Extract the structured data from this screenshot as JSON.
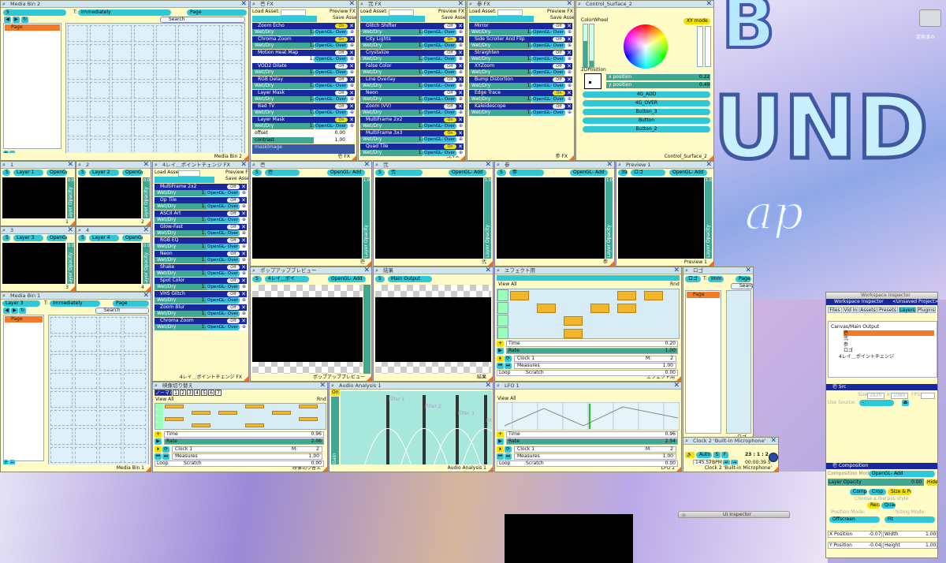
{
  "colors": {
    "panel": "#fffcc8",
    "accent": "#2ec8d8",
    "navy": "#1a28a0",
    "orange": "#f27b2a",
    "yellow": "#f3e000",
    "teal": "#3fa895"
  },
  "media_bin_2": {
    "title": "Media Bin 2",
    "trigger_label": "T:",
    "trigger_value": "Immediately",
    "page_label": "Page",
    "search": "Search",
    "list_item": "Page",
    "footer": "Media Bin 2"
  },
  "fx1": {
    "title": "壱 FX",
    "load_asset": "Load Asset:",
    "preview": "Preview FX",
    "save": "Save Asset",
    "footer": "壱 FX",
    "rows": [
      {
        "name": "Zoom Echo",
        "state": "On"
      },
      {
        "name": "Chroma Zoom",
        "state": "On"
      },
      {
        "name": "Motion Heat Map",
        "state": "Off"
      },
      {
        "name": "VOD2 Dilate",
        "state": "Off"
      },
      {
        "name": "RGB Delay",
        "state": "Off"
      },
      {
        "name": "Layer Mask",
        "state": "Off"
      },
      {
        "name": "Bad TV",
        "state": "Off"
      },
      {
        "name": "Layer Mask",
        "state": "On"
      }
    ],
    "wet": "Wet/Dry",
    "wet_val": "1.00",
    "wet_val0": "0.00",
    "blend": "OpenGL- Over",
    "offset_label": "offset",
    "offset_val": "0.00",
    "contrast_label": "contrast",
    "contrast_val": "1.00",
    "maskimage": "maskImage"
  },
  "fx2": {
    "title": "弐 FX",
    "load_asset": "Load Asset:",
    "preview": "Preview FX",
    "save": "Save Asset",
    "footer": "弐 FX",
    "rows": [
      {
        "name": "Glitch Shifter",
        "state": "Off"
      },
      {
        "name": "City Lights",
        "state": "On"
      },
      {
        "name": "Crystalize",
        "state": "Off"
      },
      {
        "name": "False Color",
        "state": "Off"
      },
      {
        "name": "Line Overlay",
        "state": "Off"
      },
      {
        "name": "Neon",
        "state": "Off"
      },
      {
        "name": "Zoom (VV)",
        "state": "Off"
      },
      {
        "name": "MultiFrame 2x2",
        "state": "On"
      },
      {
        "name": "MultiFrame 3x3",
        "state": "On"
      },
      {
        "name": "Quad Tile",
        "state": "On"
      }
    ],
    "wet": "Wet/Dry",
    "wet_val": "1.00",
    "blend": "OpenGL- Over"
  },
  "fx3": {
    "title": "参 FX",
    "load_asset": "Load Asset:",
    "preview": "Preview FX",
    "save": "Save Asset",
    "footer": "参 FX",
    "rows": [
      {
        "name": "Mirror",
        "state": "Off"
      },
      {
        "name": "Side Scroller And Flip",
        "state": "Off"
      },
      {
        "name": "Straighten",
        "state": "Off"
      },
      {
        "name": "XYZoom",
        "state": "Off"
      },
      {
        "name": "Bump Distortion",
        "state": "Off"
      },
      {
        "name": "Edge Trace",
        "state": "On"
      },
      {
        "name": "Kaleidescope",
        "state": "Off"
      }
    ],
    "wet": "Wet/Dry",
    "wet_val": "1.00",
    "blend": "OpenGL- Over"
  },
  "control_surface": {
    "title": "Control_Surface_2",
    "colorwheel": "ColorWheel",
    "xymode": "XY mode",
    "pos2d": "2DPosition",
    "xpos": "x position",
    "xval": "0.22",
    "ypos": "y position",
    "yval": "0.49",
    "buttons": [
      "4G_ADD",
      "4G_OVER",
      "Button_3",
      "Button",
      "Button_2"
    ],
    "sat": "Saturation",
    "val": "Value",
    "footer": "Control_Surface_2",
    "sliders": [
      "0.38",
      "0.14"
    ]
  },
  "layers": [
    {
      "num": "1",
      "title": "1",
      "layer": "Layer 1",
      "blend": "OpenGL-",
      "opacity": "Layer Opacity",
      "op_val": "0.00",
      "idx": "5",
      "badge": "1"
    },
    {
      "num": "2",
      "title": "2",
      "layer": "Layer 2",
      "blend": "OpenGL-",
      "opacity": "Layer Opacity",
      "op_val": "0.00",
      "idx": "5",
      "badge": "2"
    },
    {
      "num": "3",
      "title": "3",
      "layer": "Layer 3",
      "blend": "OpenGL-",
      "opacity": "Layer Opacity",
      "op_val": "0.00",
      "idx": "5",
      "badge": "3"
    },
    {
      "num": "4",
      "title": "4",
      "layer": "Layer 4",
      "blend": "OpenGL-",
      "opacity": "Layer Opacity",
      "op_val": "0.00",
      "idx": "5",
      "badge": "4"
    }
  ],
  "fx4": {
    "title": "4レイ＿ポイントチェンジ FX",
    "load_asset": "Load Asset:",
    "preview": "Preview FX",
    "save": "Save Asset",
    "footer": "4レイ＿ポイントチェンジ FX",
    "rows": [
      {
        "name": "MultiFrame 2x2",
        "state": "Off"
      },
      {
        "name": "Op Tile",
        "state": "Off"
      },
      {
        "name": "ASCII Art",
        "state": "Off"
      },
      {
        "name": "Glow-Fast",
        "state": "Off"
      },
      {
        "name": "RGB EQ",
        "state": "Off"
      },
      {
        "name": "Neon",
        "state": "Off"
      },
      {
        "name": "Shake",
        "state": "Off"
      },
      {
        "name": "Spot Color",
        "state": "Off"
      },
      {
        "name": "VHS Glitch",
        "state": "Off"
      },
      {
        "name": "Zoom Blur",
        "state": "Off"
      },
      {
        "name": "Chroma Zoom",
        "state": "Off"
      }
    ],
    "wet": "Wet/Dry",
    "wet_val": "1.00",
    "blend": "OpenGL- Over"
  },
  "previews": [
    {
      "title": "壱",
      "idx": "5",
      "name": "壱",
      "blend": "OpenGL- Add",
      "opacity": "Layer Opacity",
      "op_val": "1.00",
      "footer": "壱"
    },
    {
      "title": "弐",
      "idx": "5",
      "name": "弐",
      "blend": "OpenGL- Add",
      "opacity": "Layer Opacity",
      "op_val": "1.00",
      "footer": "弐"
    },
    {
      "title": "参",
      "idx": "5",
      "name": "参",
      "blend": "OpenGL- Add",
      "opacity": "Layer Opacity",
      "op_val": "1.00",
      "footer": "参"
    },
    {
      "title": "Preview 1",
      "idx": "39",
      "name": "ロゴ",
      "blend": "OpenGL- Add",
      "opacity": "Layer Opacity",
      "op_val": "1.00",
      "footer": "Preview 1"
    }
  ],
  "popup": {
    "title": "ポップアップブレビュー",
    "idx": "5",
    "name": "4レイ＿ポイ",
    "blend": "OpenGL- Add",
    "opacity": "Layer Opacity",
    "op_val": "1.00",
    "footer": "ポップアップブレビュー"
  },
  "result": {
    "title": "結果",
    "idx": "5",
    "name": "Main Output",
    "footer": "結果"
  },
  "effect_timeline": {
    "title": "エフェクト用",
    "view": "View All",
    "rnd": "Rnd",
    "time": "Time",
    "time_val": "0.20",
    "rate": "Rate",
    "rate_val": "1.00",
    "clock": "Clock 1",
    "m": "M:",
    "m_val": "2",
    "measures": "Measures",
    "meas_val": "1.00",
    "loop": "Loop",
    "scratch": "Scratch",
    "scratch_val": "0.00",
    "footer": "エフェクト用"
  },
  "logo_bin": {
    "title": "ロゴ",
    "t": "T:",
    "trigger": "Imm",
    "page": "Page",
    "search": "Searc",
    "item": "Page",
    "footer": "ロゴ"
  },
  "media_bin_1": {
    "title": "Media Bin 1",
    "layer": "Layer 3",
    "t": "T:",
    "trigger": "Immediately",
    "page": "Page",
    "search": "Search",
    "item": "Page",
    "footer": "Media Bin 1"
  },
  "video_switch": {
    "title": "映像切り替え",
    "tabs": [
      "ノーマル",
      "1",
      "2",
      "3",
      "4",
      "5",
      "6",
      "7"
    ],
    "view": "View All",
    "rnd": "Rnd",
    "time": "Time",
    "time_val": "0.96",
    "rate": "Rate",
    "rate_val": "2.06",
    "clock": "Clock 1",
    "m": "M:",
    "m_val": "2",
    "measures": "Measures",
    "meas_val": "1.00",
    "loop": "Loop",
    "scratch": "Scratch",
    "scratch_val": "0.00",
    "footer": "映像切り替え"
  },
  "audio": {
    "title": "Audio Analysis 1",
    "on": "On",
    "filters": [
      "Filter 1",
      "Filter 2",
      "Filter 3",
      "Filter 4"
    ],
    "gain": "Gain",
    "footer": "Audio Analysis 1"
  },
  "lfo": {
    "title": "LFO 1",
    "view": "View All",
    "time": "Time",
    "time_val": "0.96",
    "rate": "Rate",
    "rate_val": "2.54",
    "clock": "Clock 1",
    "m": "M:",
    "m_val": "2",
    "measures": "Measures",
    "meas_val": "1.00",
    "loop": "Loop",
    "scratch": "Scratch",
    "scratch_val": "0.00",
    "footer": "LFO 1"
  },
  "clock2": {
    "title": "Clock 2 'Built-in Microphone'",
    "auto": "Auto",
    "tap": "Tap",
    "bpm": "145.57",
    "bpm_label": "BPM",
    "counter": "23 : 1 : 2",
    "time": "00:00:39.5",
    "footer": "Clock 2 'Built-in Microphone'"
  },
  "ui_inspector": {
    "title": "UI Inspector"
  },
  "workspace": {
    "title": "Workspace Inspector",
    "header": "Workspace Inspector",
    "unsaved": "<Unsaved Project>",
    "tabs": [
      "Files",
      "Vid In",
      "Assets",
      "Presets",
      "Layers",
      "Plugins"
    ],
    "tree": [
      "Canvas/Main Output",
      "壱",
      "弐",
      "参",
      "ロゴ",
      "4レイ＿ポイントチェンジ"
    ],
    "src_title": "壱 Src",
    "size": "Size:",
    "size_w": "1920",
    "x": "x",
    "size_h": "1080",
    "fps": "FPS:",
    "use_source": "Use Source:",
    "use_source_val": "-",
    "comp_title": "壱 Composition",
    "comp_mode": "Composition Mode:",
    "comp_mode_val": "OpenGL- Add",
    "layer_opacity": "Layer Opacity",
    "layer_op_val": "0.00",
    "hide": "Hide",
    "comp_tabs": [
      "Comp. UI",
      "Crop",
      "Size & Pos"
    ],
    "choose": "Choose a Iberpos style",
    "rect": "Rect",
    "quad": "Quad",
    "pos_mode": "Position Mode:",
    "sizing_mode": "Sizing Mode:",
    "pos_val": "Offscreen",
    "sizing_val": "Fit",
    "xpos": "X Position",
    "xval": "-0.07",
    "width": "Width",
    "wval": "1.00",
    "ypos": "Y Position",
    "yval": "-0.04",
    "height": "Height",
    "hval": "1.00"
  },
  "desktop": {
    "drive_label": "変換済み"
  }
}
